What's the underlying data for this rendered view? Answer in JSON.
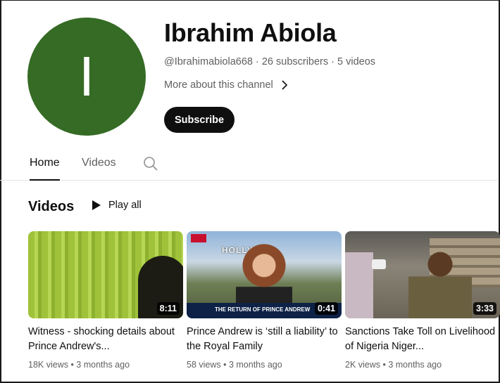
{
  "channel": {
    "avatar_letter": "I",
    "avatar_color": "#356b24",
    "name": "Ibrahim Abiola",
    "meta": "@Ibrahimabiola668 · 26 subscribers · 5 videos",
    "more_link": "More about this channel",
    "subscribe_label": "Subscribe",
    "subscribe_color": "#0f0f0f"
  },
  "tabs": [
    {
      "label": "Home",
      "active": true
    },
    {
      "label": "Videos",
      "active": false
    }
  ],
  "icons": {
    "search": "search-icon",
    "more": "chevron-right-icon",
    "play": "play-icon"
  },
  "section": {
    "title": "Videos",
    "play_all": "Play all"
  },
  "videos": [
    {
      "title": "Witness - shocking details about Prince Andrew's...",
      "duration": "8:11",
      "stats": "18K views • 3 months ago"
    },
    {
      "title": "Prince Andrew is ‘still a liability’ to the Royal Family",
      "duration": "0:41",
      "stats": "58 views • 3 months ago",
      "thumb_sign": "HOLLY",
      "thumb_banner": "THE RETURN OF PRINCE ANDREW"
    },
    {
      "title": "Sanctions Take Toll on Livelihood of Nigeria Niger...",
      "duration": "3:33",
      "stats": "2K views • 3 months ago"
    }
  ]
}
